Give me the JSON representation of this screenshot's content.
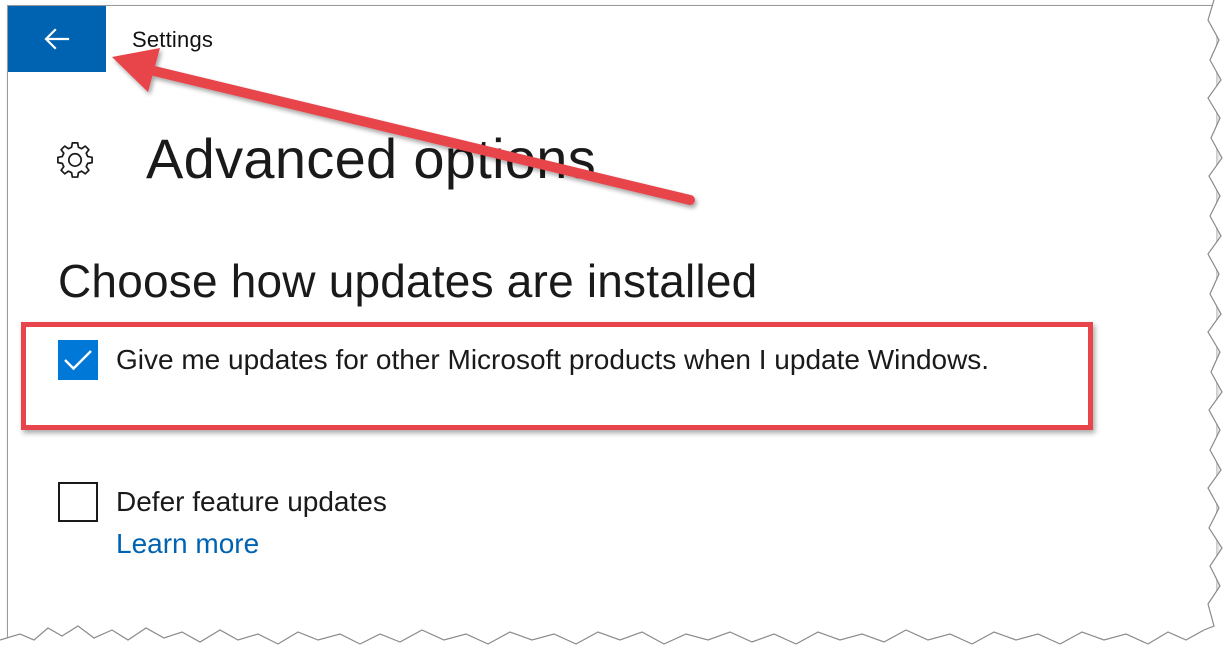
{
  "window": {
    "title": "Settings"
  },
  "back_button": {
    "icon": "back-arrow-icon",
    "color": "#0063b1"
  },
  "header": {
    "icon": "gear-icon",
    "title": "Advanced options"
  },
  "section": {
    "title": "Choose how updates are installed"
  },
  "options": {
    "other_products": {
      "label": "Give me updates for other Microsoft products when I update Windows.",
      "checked": true
    },
    "defer_features": {
      "label": "Defer feature updates",
      "checked": false,
      "link": "Learn more"
    }
  },
  "annotations": {
    "color": "#e8444b",
    "arrow_target": "back-button",
    "highlight_target": "other-products-option"
  },
  "colors": {
    "accent": "#0078d7",
    "link": "#0063b1",
    "text": "#1a1a1a",
    "annotation": "#e8444b"
  }
}
